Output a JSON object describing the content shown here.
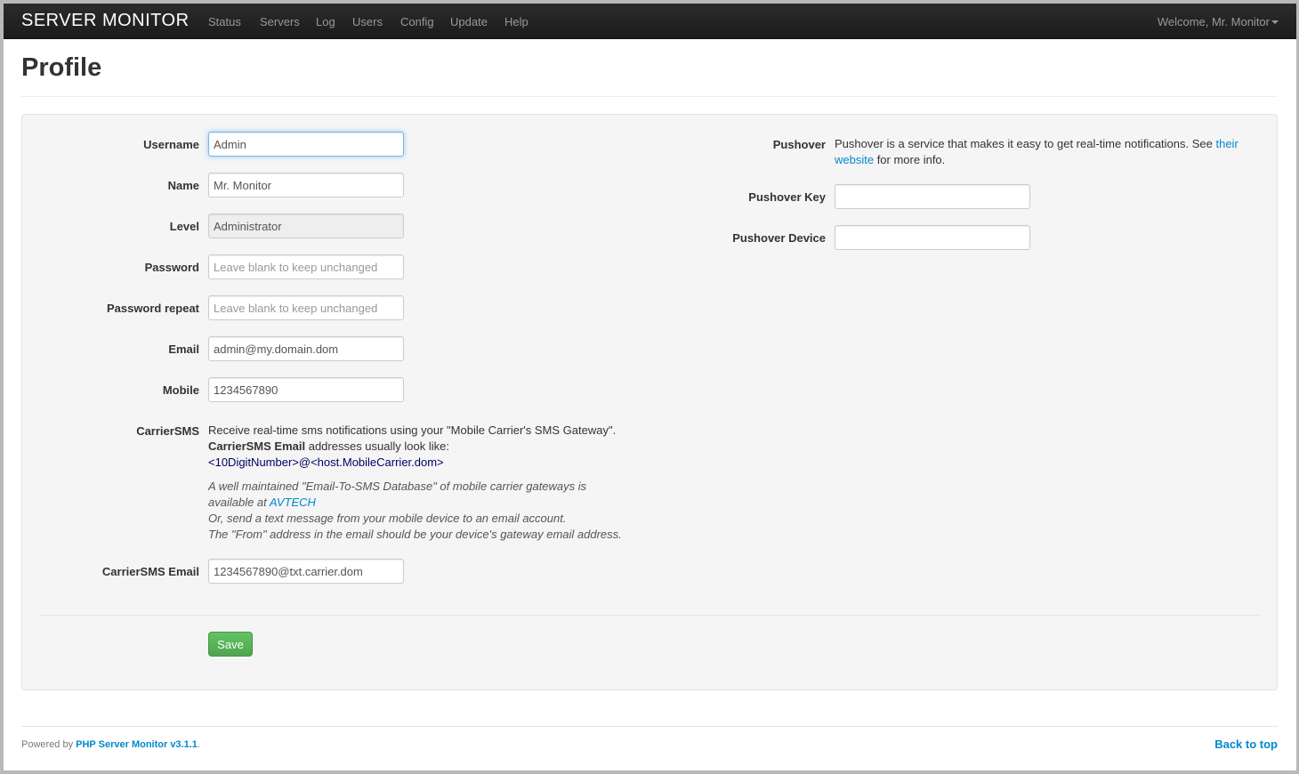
{
  "navbar": {
    "brand": "SERVER MONITOR",
    "items": [
      "Status",
      "Servers",
      "Log",
      "Users",
      "Config",
      "Update",
      "Help"
    ],
    "welcome": "Welcome, Mr. Monitor"
  },
  "page": {
    "title": "Profile"
  },
  "form": {
    "username": {
      "label": "Username",
      "value": "Admin"
    },
    "name": {
      "label": "Name",
      "value": "Mr. Monitor"
    },
    "level": {
      "label": "Level",
      "value": "Administrator"
    },
    "password": {
      "label": "Password",
      "placeholder": "Leave blank to keep unchanged"
    },
    "password_repeat": {
      "label": "Password repeat",
      "placeholder": "Leave blank to keep unchanged"
    },
    "email": {
      "label": "Email",
      "value": "admin@my.domain.dom"
    },
    "mobile": {
      "label": "Mobile",
      "value": "1234567890"
    },
    "carriersms": {
      "label": "CarrierSMS",
      "line1": "Receive real-time sms notifications using your \"Mobile Carrier's SMS Gateway\".",
      "line2_bold": "CarrierSMS Email",
      "line2_rest": " addresses usually look like:",
      "line3": "<10DigitNumber>@<host.MobileCarrier.dom>",
      "note1": "A well maintained \"Email-To-SMS Database\" of mobile carrier gateways is",
      "note2_pre": "available at ",
      "note2_link": "AVTECH",
      "note3": "Or, send a text message from your mobile device to an email account.",
      "note4": "The \"From\" address in the email should be your device's gateway email address."
    },
    "carriersms_email": {
      "label": "CarrierSMS Email",
      "value": "1234567890@txt.carrier.dom"
    },
    "pushover": {
      "label": "Pushover",
      "text1": "Pushover is a service that makes it easy to get real-time notifications. See ",
      "link1": "their",
      "link2": "website",
      "text2": " for more info."
    },
    "pushover_key": {
      "label": "Pushover Key",
      "value": ""
    },
    "pushover_device": {
      "label": "Pushover Device",
      "value": ""
    },
    "save_label": "Save"
  },
  "footer": {
    "powered_by": "Powered by ",
    "app_link": "PHP Server Monitor v3.1.1",
    "period": ".",
    "back_to_top": "Back to top"
  },
  "colors": {
    "navbar_bg": "#1b1b1b",
    "link": "#0088cc",
    "save_button": "#51a351"
  }
}
